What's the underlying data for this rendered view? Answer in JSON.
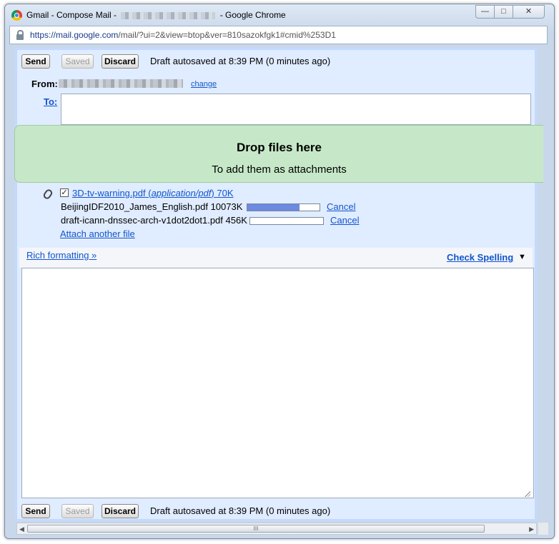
{
  "window": {
    "title_prefix": "Gmail - Compose Mail - ",
    "title_suffix": " - Google Chrome",
    "controls": {
      "minimize": "—",
      "maximize": "□",
      "close": "✕"
    }
  },
  "address": {
    "scheme_host": "https://mail.google.com",
    "path": "/mail/?ui=2&view=btop&ver=810sazokfgk1#cmid%253D1"
  },
  "toolbar_top": {
    "send": "Send",
    "saved": "Saved",
    "discard": "Discard",
    "status": "Draft autosaved at 8:39 PM (0 minutes ago)"
  },
  "from": {
    "label": "From:",
    "change": "change"
  },
  "to": {
    "label": "To:",
    "value": ""
  },
  "dropzone": {
    "title": "Drop files here",
    "subtitle": "To add them as attachments"
  },
  "attachments": {
    "attached": {
      "name": "3D-tv-warning.pdf",
      "type": "application/pdf",
      "size": "70K"
    },
    "uploads": [
      {
        "name": "BeijingIDF2010_James_English.pdf 10073K",
        "progress": 0.72,
        "cancel": "Cancel"
      },
      {
        "name": "draft-icann-dnssec-arch-v1dot2dot1.pdf 456K",
        "progress": 0.0,
        "cancel": "Cancel"
      }
    ],
    "attach_another": "Attach another file"
  },
  "editor": {
    "rich_formatting": "Rich formatting »",
    "check_spelling": "Check Spelling",
    "check_arrow": "▼",
    "body": ""
  },
  "toolbar_bottom": {
    "send": "Send",
    "saved": "Saved",
    "discard": "Discard",
    "status": "Draft autosaved at 8:39 PM (0 minutes ago)"
  },
  "scrollbar": {
    "left_arrow": "◀",
    "right_arrow": "▶",
    "grip": "III"
  }
}
